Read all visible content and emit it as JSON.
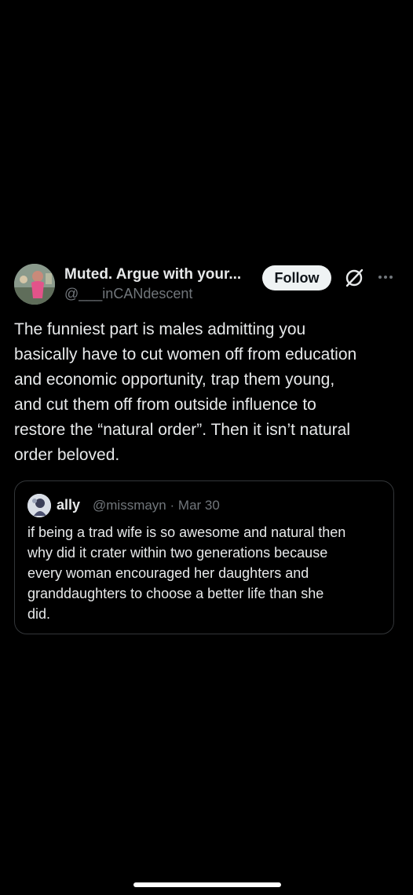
{
  "author": {
    "display_name": "Muted. Argue with your...",
    "handle": "@___inCANdescent",
    "avatar_icon": "profile-photo-avatar"
  },
  "actions": {
    "follow_label": "Follow",
    "grok_icon": "grok-icon",
    "more_icon": "more-options-icon"
  },
  "tweet": {
    "text": "The funniest part is males admitting you\nbasically have to cut women off from education\nand economic opportunity, trap them young,\nand cut them off from outside influence to\nrestore the “natural order”. Then it isn’t natural\norder beloved."
  },
  "quoted_tweet": {
    "display_name": "ally",
    "handle": "@missmayn",
    "separator": "·",
    "date": "Mar 30",
    "text": "if being a trad wife is so awesome and natural then\nwhy did it crater within two generations because\nevery woman encouraged her daughters and\ngranddaughters to choose a better life than she\ndid.",
    "avatar_icon": "profile-photo-avatar"
  },
  "colors": {
    "background": "#000000",
    "primary_text": "#e7e9ea",
    "secondary_text": "#71767b",
    "border": "#333639",
    "follow_button_bg": "#eff3f4"
  }
}
